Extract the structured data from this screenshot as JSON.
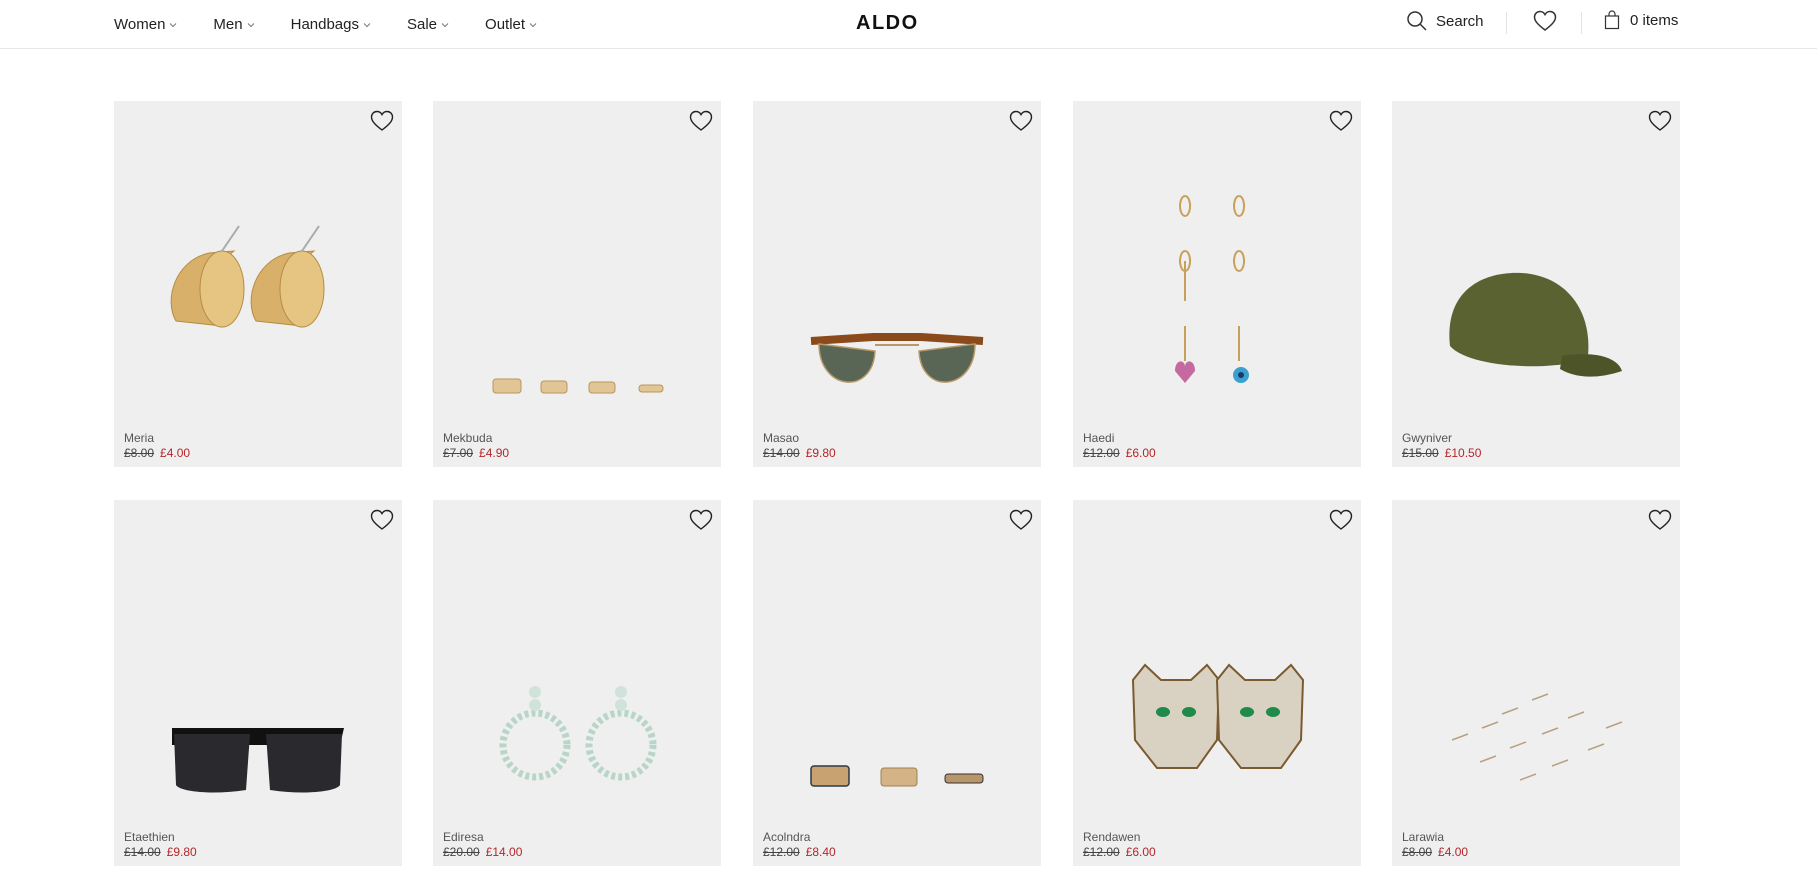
{
  "header": {
    "nav": [
      "Women",
      "Men",
      "Handbags",
      "Sale",
      "Outlet"
    ],
    "logo": "ALDO",
    "search_label": "Search",
    "bag_label": "0 items"
  },
  "colors": {
    "sale_price": "#b3262a",
    "card_bg": "#efefef",
    "divider": "#e6e6e6"
  },
  "products": [
    {
      "name": "Meria",
      "old_price": "£8.00",
      "price": "£4.00",
      "image": "gold-hoop-earrings"
    },
    {
      "name": "Mekbuda",
      "old_price": "£7.00",
      "price": "£4.90",
      "image": "gold-rings"
    },
    {
      "name": "Masao",
      "old_price": "£14.00",
      "price": "£9.80",
      "image": "tortoise-sunglasses"
    },
    {
      "name": "Haedi",
      "old_price": "£12.00",
      "price": "£6.00",
      "image": "earring-set"
    },
    {
      "name": "Gwyniver",
      "old_price": "£15.00",
      "price": "£10.50",
      "image": "olive-cap"
    },
    {
      "name": "Etaethien",
      "old_price": "£14.00",
      "price": "£9.80",
      "image": "black-sunglasses"
    },
    {
      "name": "Ediresa",
      "old_price": "£20.00",
      "price": "£14.00",
      "image": "crystal-hoop-earrings"
    },
    {
      "name": "Acolndra",
      "old_price": "£12.00",
      "price": "£8.40",
      "image": "stacked-rings"
    },
    {
      "name": "Rendawen",
      "old_price": "£12.00",
      "price": "£6.00",
      "image": "panther-earrings"
    },
    {
      "name": "Larawia",
      "old_price": "£8.00",
      "price": "£4.00",
      "image": "stud-earrings"
    }
  ]
}
